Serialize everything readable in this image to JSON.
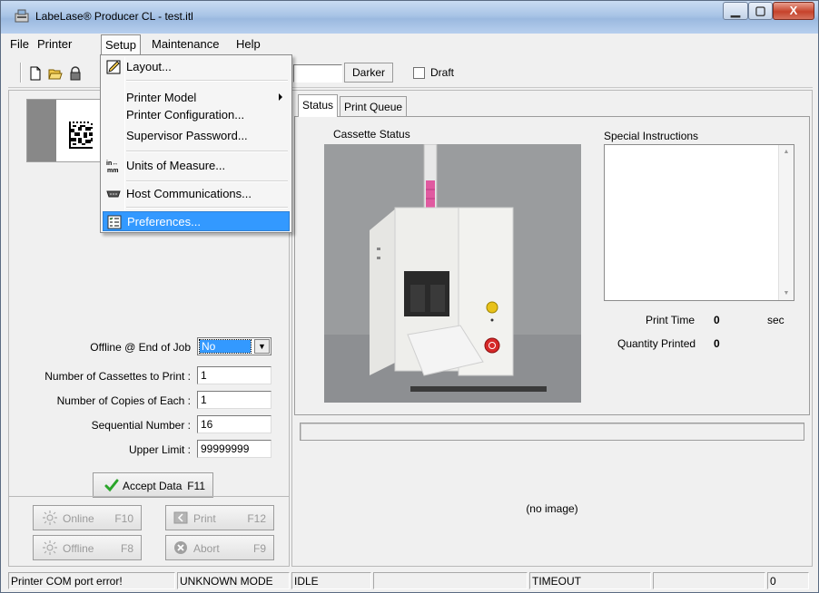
{
  "window": {
    "title": "LabeLase® Producer CL - test.itl",
    "min_glyph": "▁",
    "max_glyph": "▢",
    "close_glyph": "X"
  },
  "menubar": {
    "items": [
      "File",
      "Printer",
      "Setup",
      "Maintenance",
      "Help"
    ]
  },
  "setup_menu": {
    "items": [
      {
        "label": "Layout...",
        "icon": "layout-pencil-icon"
      },
      {
        "label": "Printer Model",
        "icon": "",
        "submenu": true
      },
      {
        "label": "Printer Configuration...",
        "icon": ""
      },
      {
        "label": "Supervisor Password...",
        "icon": ""
      },
      {
        "label": "Units of Measure...",
        "icon": "units-icon"
      },
      {
        "label": "Host Communications...",
        "icon": "serial-cable-icon"
      },
      {
        "label": "Preferences...",
        "icon": "preferences-icon",
        "highlighted": true
      }
    ],
    "units_icon_text": "in↔\nmm"
  },
  "toolbar": {
    "darker_label": "Darker",
    "draft_label": "Draft",
    "icons": [
      "new-file-icon",
      "open-folder-icon",
      "lock-icon"
    ]
  },
  "form": {
    "offline_end_label": "Offline @ End of Job",
    "offline_end_value": "No",
    "cassettes_label": "Number of Cassettes to Print :",
    "cassettes_value": "1",
    "copies_label": "Number of Copies of Each :",
    "copies_value": "1",
    "sequential_label": "Sequential Number :",
    "sequential_value": "16",
    "upper_label": "Upper Limit :",
    "upper_value": "99999999"
  },
  "buttons": {
    "accept": {
      "label": "Accept Data",
      "key": "F11"
    },
    "online": {
      "label": "Online",
      "key": "F10"
    },
    "print": {
      "label": "Print",
      "key": "F12"
    },
    "offline": {
      "label": "Offline",
      "key": "F8"
    },
    "abort": {
      "label": "Abort",
      "key": "F9"
    }
  },
  "tabs": [
    {
      "label": "Status",
      "active": true
    },
    {
      "label": "Print Queue",
      "active": false
    }
  ],
  "status_panel": {
    "cassette_status_label": "Cassette Status",
    "special_instructions_label": "Special Instructions",
    "print_time_label": "Print Time",
    "print_time_value": "0",
    "print_time_unit": "sec",
    "quantity_label": "Quantity Printed",
    "quantity_value": "0"
  },
  "no_image_text": "(no image)",
  "statusbar": {
    "cells": [
      "Printer COM port error!",
      "UNKNOWN MODE",
      "IDLE",
      "",
      "TIMEOUT",
      "",
      "0"
    ]
  },
  "colors": {
    "highlight": "#3399ff",
    "accept_check": "#2aa52a",
    "close_button": "#c6432b",
    "cassette_pink": "#e05aa0"
  }
}
